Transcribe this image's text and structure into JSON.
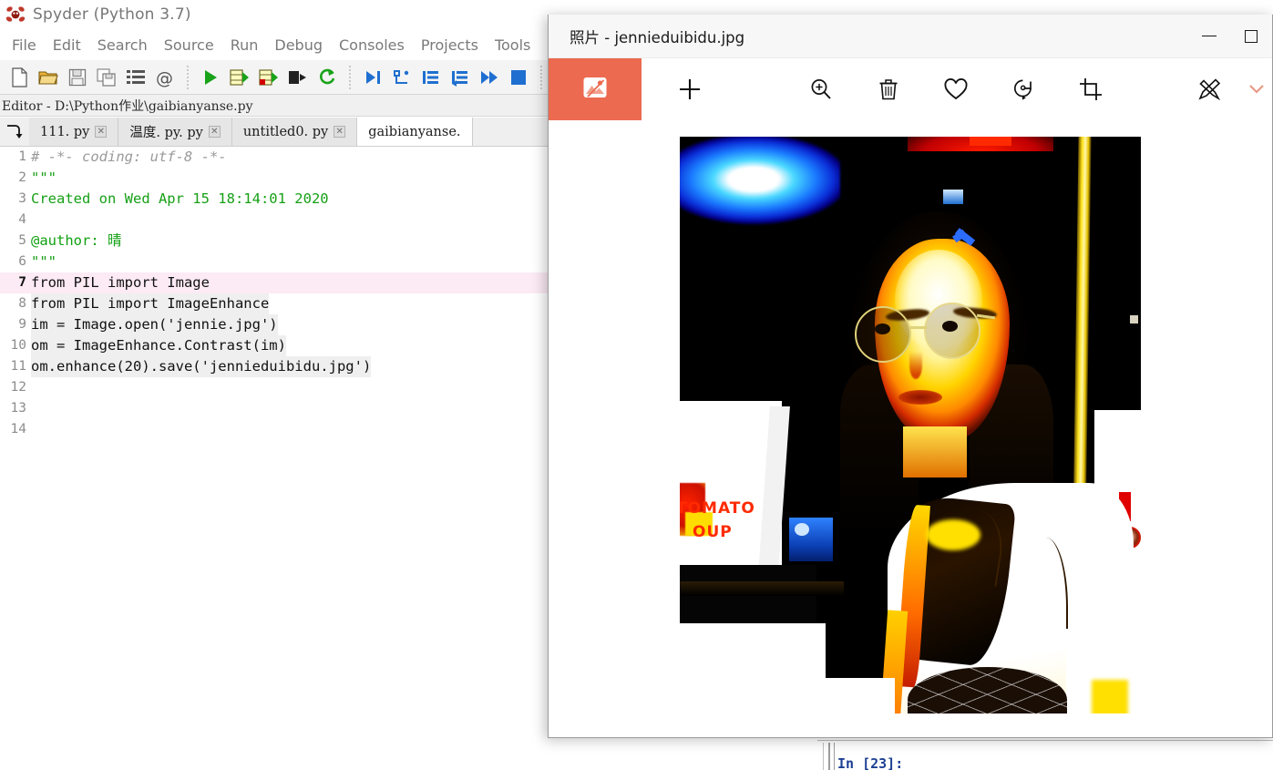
{
  "spyder": {
    "title": "Spyder (Python 3.7)",
    "logo_icon": "spyder-logo-icon",
    "menus": [
      "File",
      "Edit",
      "Search",
      "Source",
      "Run",
      "Debug",
      "Consoles",
      "Projects",
      "Tools"
    ],
    "toolbar_icons": [
      "new-file-icon",
      "open-file-icon",
      "save-file-icon",
      "save-all-icon",
      "file-list-icon",
      "at-symbol-icon",
      "run-file-icon",
      "run-cell-icon",
      "run-cell-advance-icon",
      "run-selection-icon",
      "rerun-icon",
      "debug-file-icon",
      "step-over-icon",
      "step-into-icon",
      "step-return-icon",
      "continue-icon",
      "stop-debug-icon",
      "debug-extra-icon"
    ],
    "editor_label": "Editor - D:\\Python作业\\gaibianyanse.py",
    "tab_browse_icon": "browse-tabs-icon",
    "tabs": [
      {
        "label": "111. py",
        "active": false,
        "close_icon": "close-icon"
      },
      {
        "label": "温度. py. py",
        "active": false,
        "close_icon": "close-icon"
      },
      {
        "label": "untitled0. py",
        "active": false,
        "close_icon": "close-icon"
      },
      {
        "label": "gaibianyanse.",
        "active": true,
        "close_icon": "close-icon"
      }
    ],
    "code_lines": [
      {
        "n": "1",
        "text": "# -*- coding: utf-8 -*-",
        "style": "comment",
        "current": false
      },
      {
        "n": "2",
        "text": "\"\"\"",
        "style": "string",
        "current": false
      },
      {
        "n": "3",
        "text": "Created on Wed Apr 15 18:14:01 2020",
        "style": "string",
        "current": false
      },
      {
        "n": "4",
        "text": "",
        "style": "plain",
        "current": false
      },
      {
        "n": "5",
        "text": "@author: 晴",
        "style": "decorator",
        "current": false
      },
      {
        "n": "6",
        "text": "\"\"\"",
        "style": "string",
        "current": false
      },
      {
        "n": "7",
        "text": "from PIL import Image",
        "style": "plain",
        "current": true
      },
      {
        "n": "8",
        "text": "from PIL import ImageEnhance",
        "style": "plain",
        "current": false
      },
      {
        "n": "9",
        "text": "im = Image.open('jennie.jpg')",
        "style": "plain",
        "current": false
      },
      {
        "n": "10",
        "text": "om = ImageEnhance.Contrast(im)",
        "style": "plain",
        "current": false
      },
      {
        "n": "11",
        "text": "om.enhance(20).save('jennieduibidu.jpg')",
        "style": "plain",
        "current": false
      },
      {
        "n": "12",
        "text": "",
        "style": "plain",
        "current": false
      },
      {
        "n": "13",
        "text": "",
        "style": "plain",
        "current": false
      },
      {
        "n": "14",
        "text": "",
        "style": "plain",
        "current": false
      }
    ],
    "console_prompt": "In [23]:"
  },
  "photos": {
    "window_title": "照片 - jennieduibidu.jpg",
    "app_tile_icon": "photos-app-icon",
    "app_tile_color": "#EC6A50",
    "window_controls": [
      {
        "name": "minimize-button",
        "icon": "minimize-icon"
      },
      {
        "name": "maximize-button",
        "icon": "maximize-icon"
      }
    ],
    "toolbar_buttons": [
      {
        "name": "add-button",
        "icon": "plus-icon",
        "label": "添加"
      },
      {
        "name": "zoom-button",
        "icon": "magnifier-plus-icon",
        "label": "缩放"
      },
      {
        "name": "delete-button",
        "icon": "trash-icon",
        "label": "删除"
      },
      {
        "name": "favorite-button",
        "icon": "heart-icon",
        "label": "收藏"
      },
      {
        "name": "rotate-button",
        "icon": "rotate-icon",
        "label": "旋转"
      },
      {
        "name": "crop-button",
        "icon": "crop-icon",
        "label": "裁剪"
      },
      {
        "name": "edit-create-button",
        "icon": "pencil-brush-icon",
        "label": "编辑和创建"
      },
      {
        "name": "more-button",
        "icon": "chevron-down-icon",
        "label": "更多"
      }
    ],
    "image": {
      "name": "jennieduibidu.jpg",
      "alt": "High-contrast enhanced night portrait of a woman with round glasses",
      "poster_text_line1": "TOMATO",
      "poster_text_line2": "OUP"
    }
  }
}
